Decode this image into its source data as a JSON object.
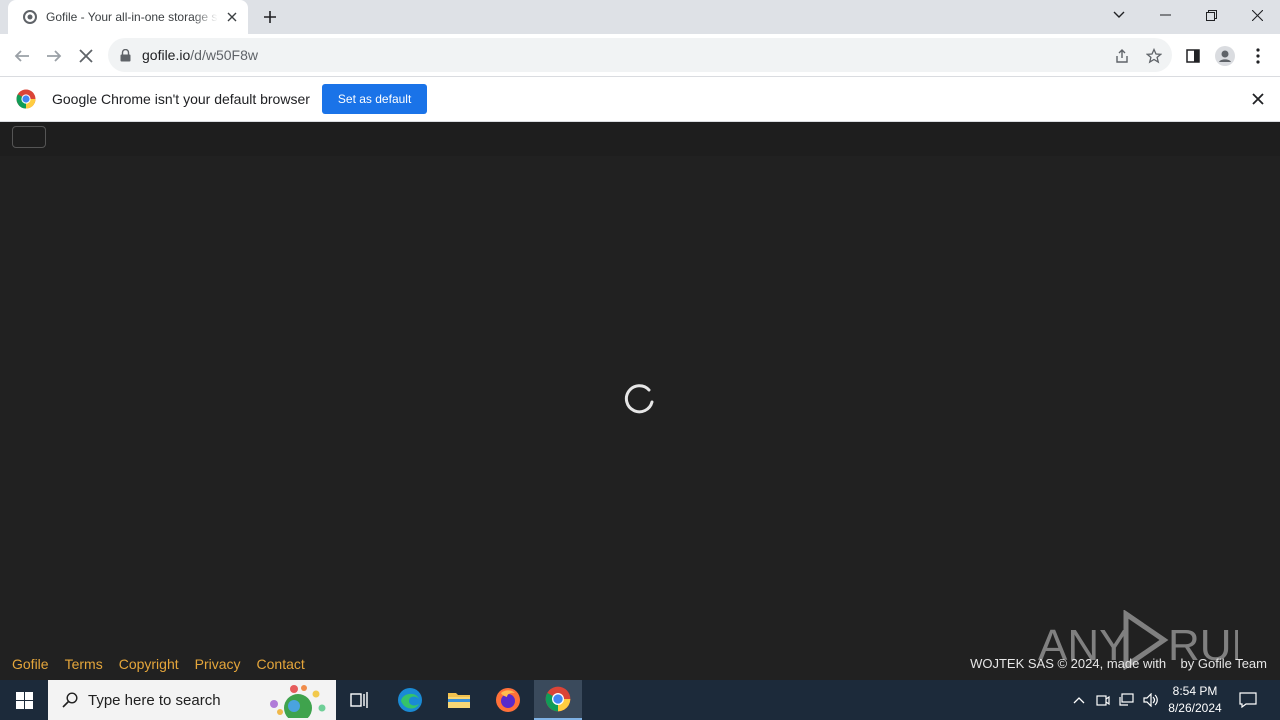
{
  "browser": {
    "tab_title": "Gofile - Your all-in-one storage solution",
    "url_host": "gofile.io",
    "url_path": "/d/w50F8w"
  },
  "infobar": {
    "message": "Google Chrome isn't your default browser",
    "button_label": "Set as default"
  },
  "footer": {
    "links": [
      "Gofile",
      "Terms",
      "Copyright",
      "Privacy",
      "Contact"
    ],
    "credit": "WOJTEK SAS © 2024, made with    by Gofile Team"
  },
  "taskbar": {
    "search_placeholder": "Type here to search",
    "time": "8:54 PM",
    "date": "8/26/2024"
  },
  "colors": {
    "page_bg": "#212121",
    "footer_link": "#e5a63b",
    "chrome_blue": "#1a73e8"
  }
}
